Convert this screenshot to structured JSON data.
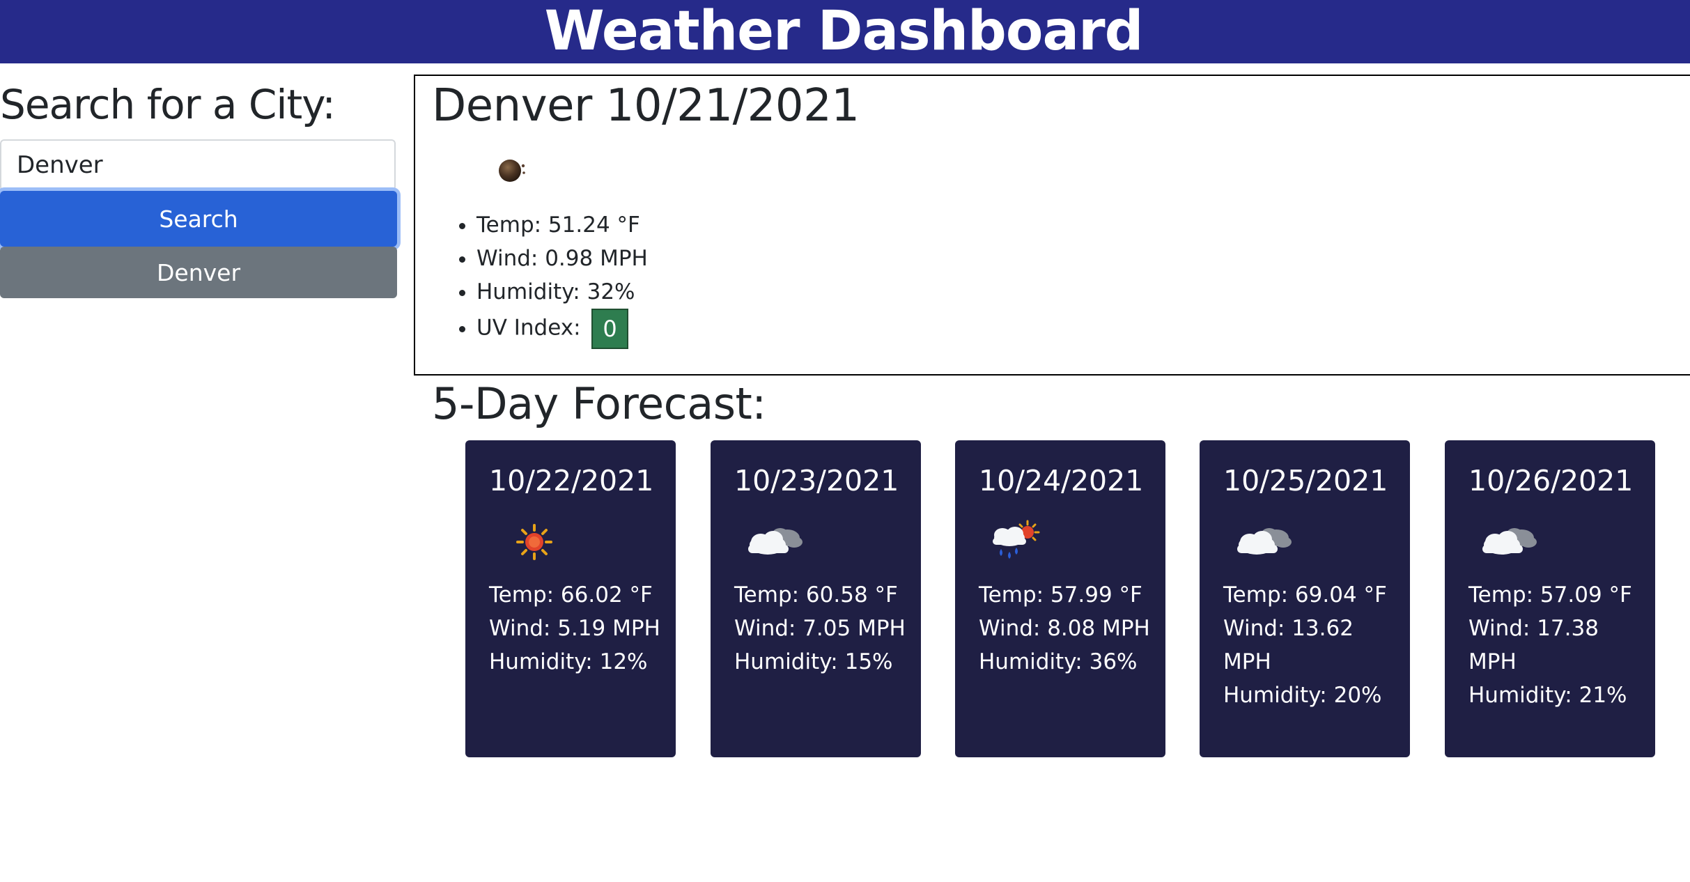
{
  "header": {
    "title": "Weather Dashboard"
  },
  "sidebar": {
    "heading": "Search for a City:",
    "search_value": "Denver",
    "search_button_label": "Search",
    "history": [
      {
        "label": "Denver"
      }
    ]
  },
  "current": {
    "title": "Denver 10/21/2021",
    "icon": "dark-moon-night-icon",
    "temp": "Temp: 51.24 °F",
    "wind": "Wind: 0.98 MPH",
    "humidity": "Humidity: 32%",
    "uv_label": "UV Index:",
    "uv_value": "0",
    "uv_color": "#2E7D4F"
  },
  "forecast": {
    "heading": "5-Day Forecast:",
    "days": [
      {
        "date": "10/22/2021",
        "icon": "sun-icon",
        "temp": "Temp: 66.02 °F",
        "wind": "Wind: 5.19 MPH",
        "humidity": "Humidity: 12%"
      },
      {
        "date": "10/23/2021",
        "icon": "cloudy-icon",
        "temp": "Temp: 60.58 °F",
        "wind": "Wind: 7.05 MPH",
        "humidity": "Humidity: 15%"
      },
      {
        "date": "10/24/2021",
        "icon": "rain-sun-icon",
        "temp": "Temp: 57.99 °F",
        "wind": "Wind: 8.08 MPH",
        "humidity": "Humidity: 36%"
      },
      {
        "date": "10/25/2021",
        "icon": "cloudy-icon",
        "temp": "Temp: 69.04 °F",
        "wind": "Wind: 13.62 MPH",
        "humidity": "Humidity: 20%"
      },
      {
        "date": "10/26/2021",
        "icon": "cloudy-icon",
        "temp": "Temp: 57.09 °F",
        "wind": "Wind: 17.38 MPH",
        "humidity": "Humidity: 21%"
      }
    ],
    "card_color": "#1F1F44"
  },
  "colors": {
    "header_bg": "#262A8A",
    "search_button": "#2862D6",
    "history_button": "#6C757D"
  }
}
